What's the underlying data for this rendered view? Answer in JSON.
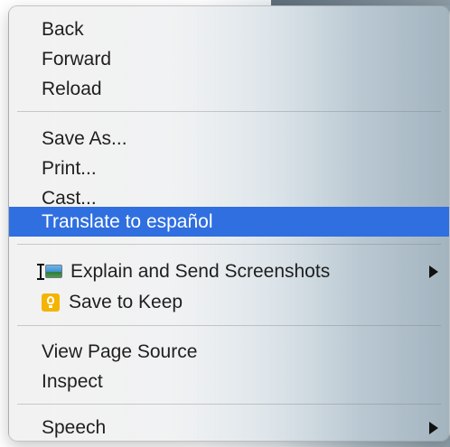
{
  "context_menu": {
    "groups": [
      {
        "items": [
          {
            "label": "Back"
          },
          {
            "label": "Forward"
          },
          {
            "label": "Reload"
          }
        ]
      },
      {
        "items": [
          {
            "label": "Save As..."
          },
          {
            "label": "Print..."
          },
          {
            "label": "Cast..."
          },
          {
            "label": "Translate to español",
            "highlighted": true
          }
        ]
      },
      {
        "items": [
          {
            "label": "Explain and Send Screenshots",
            "icon": "screenshot-icon",
            "submenu": true
          },
          {
            "label": "Save to Keep",
            "icon": "keep-bulb-icon"
          }
        ]
      },
      {
        "items": [
          {
            "label": "View Page Source"
          },
          {
            "label": "Inspect"
          }
        ]
      },
      {
        "items": [
          {
            "label": "Speech",
            "submenu": true
          }
        ]
      }
    ],
    "highlight_color": "#2f6fe0"
  }
}
